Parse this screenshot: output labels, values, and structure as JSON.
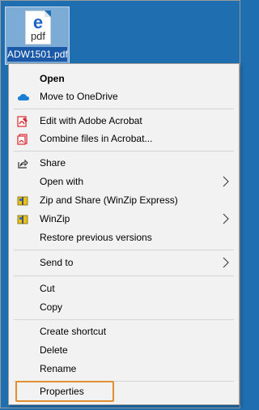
{
  "desktop_file": {
    "badge_letter": "e",
    "extension_text": "pdf",
    "name": "ADW1501.pdf"
  },
  "menu": {
    "open": "Open",
    "move_to_onedrive": "Move to OneDrive",
    "edit_acrobat": "Edit with Adobe Acrobat",
    "combine_acrobat": "Combine files in Acrobat...",
    "share": "Share",
    "open_with": "Open with",
    "zip_and_share": "Zip and Share (WinZip Express)",
    "winzip": "WinZip",
    "restore_versions": "Restore previous versions",
    "send_to": "Send to",
    "cut": "Cut",
    "copy": "Copy",
    "create_shortcut": "Create shortcut",
    "delete": "Delete",
    "rename": "Rename",
    "properties": "Properties"
  },
  "colors": {
    "desktop": "#1f6fb0",
    "menu_bg": "#f2f2f2",
    "highlight": "#e09030",
    "onedrive": "#1a7fd4",
    "acrobat": "#d7282f",
    "winzip": "#e8c21c"
  }
}
